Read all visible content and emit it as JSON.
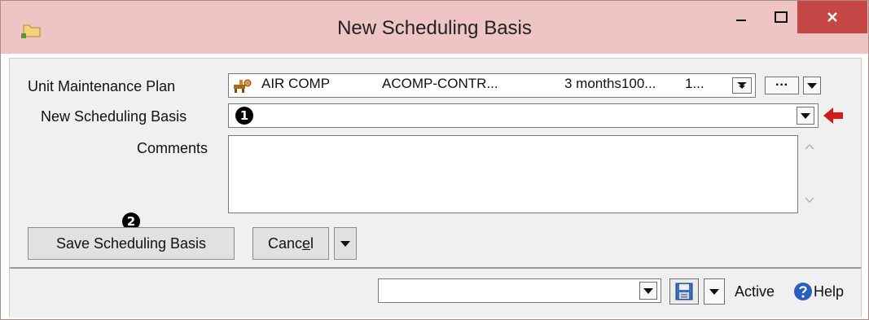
{
  "window": {
    "title": "New Scheduling Basis"
  },
  "form": {
    "plan_label": "Unit Maintenance Plan",
    "plan_value": {
      "col1": "AIR COMP",
      "col2": "ACOMP-CONTR...",
      "col3": "3 months100...",
      "col4": "1..."
    },
    "plan_more_label": "···",
    "basis_label": "New Scheduling Basis",
    "basis_value": "",
    "comments_label": "Comments",
    "comments_value": ""
  },
  "callouts": {
    "first": "1",
    "second": "2"
  },
  "buttons": {
    "save": "Save Scheduling Basis",
    "cancel_prefix": "Canc",
    "cancel_mnemonic": "e",
    "cancel_suffix": "l"
  },
  "status": {
    "combo_value": "",
    "active_label": "Active",
    "help_label": "Help"
  },
  "colors": {
    "accent_red": "#d21c1c",
    "close_bg": "#c74646",
    "title_bg": "#efc4c4"
  }
}
